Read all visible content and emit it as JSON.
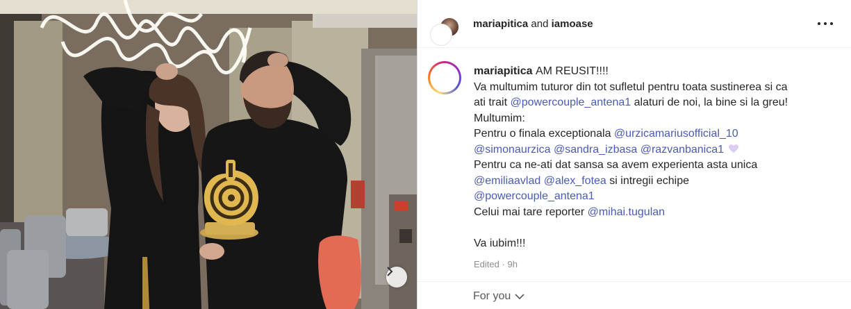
{
  "header": {
    "user1": "mariapitica",
    "connector": "and",
    "user2": "iamoase",
    "more_icon": "more-horizontal-icon"
  },
  "caption": {
    "username": "mariapitica",
    "lines": [
      [
        {
          "t": "AM REUSIT!!!!"
        }
      ],
      [
        {
          "t": "Va multumim tuturor din tot sufletul pentru toata sustinerea si ca"
        }
      ],
      [
        {
          "t": "ati trait "
        },
        {
          "m": "@powercouple_antena1"
        },
        {
          "t": " alaturi de noi, la bine si la greu!"
        }
      ],
      [
        {
          "t": "Multumim:"
        }
      ],
      [
        {
          "t": "Pentru o finala exceptionala "
        },
        {
          "m": "@urzicamariusofficial_10"
        }
      ],
      [
        {
          "m": "@simonaurzica"
        },
        {
          "t": " "
        },
        {
          "m": "@sandra_izbasa"
        },
        {
          "t": " "
        },
        {
          "m": "@razvanbanica1"
        }
      ],
      [
        {
          "t": "Pentru ca ne-ati dat sansa sa avem experienta asta unica"
        }
      ],
      [
        {
          "m": "@emiliaavlad"
        },
        {
          "t": " "
        },
        {
          "m": "@alex_fotea"
        },
        {
          "t": " si intregii echipe"
        }
      ],
      [
        {
          "m": "@powercouple_antena1"
        }
      ],
      [
        {
          "t": "Celui mai tare reporter "
        },
        {
          "m": "@mihai.tugulan"
        }
      ],
      [
        {
          "t": ""
        }
      ],
      [
        {
          "t": "Va iubim!!!"
        }
      ]
    ],
    "edited": "Edited",
    "separator": "·",
    "time": "9h"
  },
  "footer": {
    "for_you": "For you"
  },
  "colors": {
    "mention": "#4a5bb5",
    "meta": "#8e8e8e"
  }
}
